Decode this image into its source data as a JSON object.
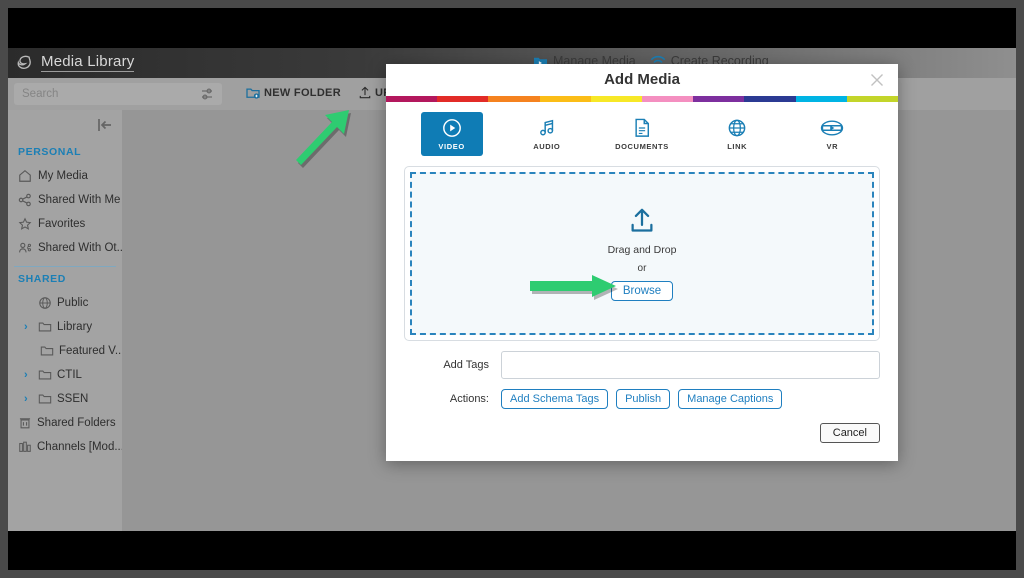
{
  "app": {
    "title": "Media Library",
    "header_items": [
      {
        "label": "Manage Media",
        "icon": "video-folder-icon"
      },
      {
        "label": "Create Recording",
        "icon": "wifi-broadcast-icon"
      }
    ]
  },
  "toolbar": {
    "search_placeholder": "Search",
    "new_folder_label": "NEW FOLDER",
    "upload_label": "UPLOAD"
  },
  "sidebar": {
    "personal_heading": "PERSONAL",
    "personal_items": [
      {
        "label": "My Media",
        "icon": "home-icon"
      },
      {
        "label": "Shared With Me",
        "icon": "share-icon"
      },
      {
        "label": "Favorites",
        "icon": "star-icon"
      },
      {
        "label": "Shared With Ot...",
        "icon": "user-share-icon"
      }
    ],
    "shared_heading": "SHARED",
    "shared_items": [
      {
        "label": "Public",
        "icon": "globe-icon",
        "indent": 0,
        "expandable": false
      },
      {
        "label": "Library",
        "icon": "folder-icon",
        "indent": 1,
        "expandable": true
      },
      {
        "label": "Featured V...",
        "icon": "folder-icon",
        "indent": 2,
        "expandable": false
      },
      {
        "label": "CTIL",
        "icon": "folder-icon",
        "indent": 1,
        "expandable": true
      },
      {
        "label": "SSEN",
        "icon": "folder-icon",
        "indent": 1,
        "expandable": true
      },
      {
        "label": "Shared Folders",
        "icon": "trash-folder-icon",
        "indent": 0,
        "expandable": false
      },
      {
        "label": "Channels [Mod...",
        "icon": "channels-icon",
        "indent": 0,
        "expandable": false
      }
    ]
  },
  "modal": {
    "title": "Add Media",
    "close_label": "×",
    "stripe_colors": [
      "#b3185d",
      "#e22b27",
      "#f5821f",
      "#fbbd17",
      "#f7e827",
      "#f48fc0",
      "#7d2f9e",
      "#2b3a93",
      "#00b4e4",
      "#c3d52a"
    ],
    "tabs": [
      {
        "label": "VIDEO",
        "icon": "video-play-icon",
        "active": true
      },
      {
        "label": "AUDIO",
        "icon": "music-note-icon",
        "active": false
      },
      {
        "label": "DOCUMENTS",
        "icon": "document-icon",
        "active": false
      },
      {
        "label": "LINK",
        "icon": "globe-icon",
        "active": false
      },
      {
        "label": "VR",
        "icon": "vr-headset-icon",
        "active": false
      }
    ],
    "dropzone": {
      "icon": "upload-tray-icon",
      "drag_text": "Drag and Drop",
      "or_text": "or",
      "browse_label": "Browse"
    },
    "tags_label": "Add Tags",
    "tags_value": "",
    "actions_label": "Actions:",
    "action_buttons": [
      "Add Schema Tags",
      "Publish",
      "Manage Captions"
    ],
    "cancel_label": "Cancel"
  },
  "annotations": {
    "arrow_color": "#2ecc71",
    "arrows": [
      {
        "name": "arrow-to-upload",
        "target": "UPLOAD"
      },
      {
        "name": "arrow-to-browse",
        "target": "Browse"
      }
    ]
  }
}
